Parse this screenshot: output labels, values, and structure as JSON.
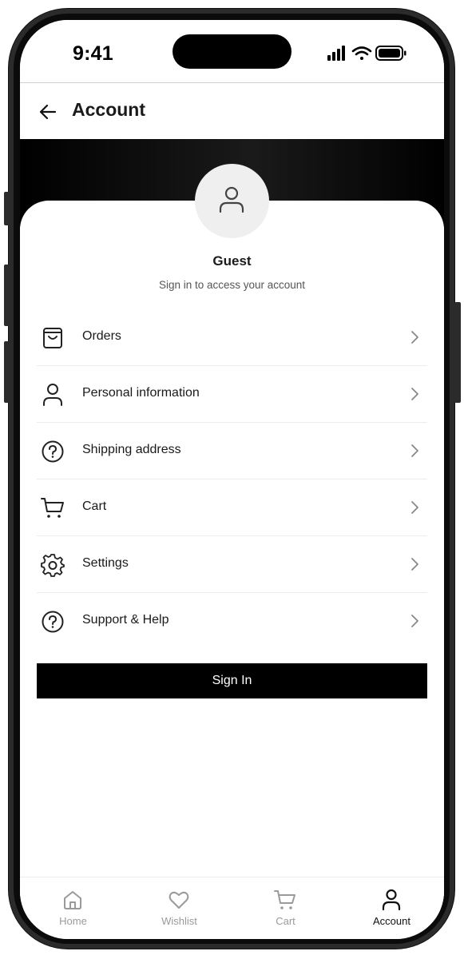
{
  "status_bar": {
    "time": "9:41"
  },
  "header": {
    "title": "Account"
  },
  "profile": {
    "name": "Guest",
    "subtitle": "Sign in to access your account"
  },
  "menu": [
    {
      "label": "Orders",
      "icon": "bag-icon"
    },
    {
      "label": "Personal information",
      "icon": "user-icon"
    },
    {
      "label": "Shipping address",
      "icon": "help-circle-icon"
    },
    {
      "label": "Cart",
      "icon": "cart-icon"
    },
    {
      "label": "Settings",
      "icon": "gear-icon"
    },
    {
      "label": "Support & Help",
      "icon": "help-circle-icon"
    }
  ],
  "signin": {
    "label": "Sign In"
  },
  "bottom_nav": [
    {
      "label": "Home",
      "icon": "home-icon",
      "active": false
    },
    {
      "label": "Wishlist",
      "icon": "heart-icon",
      "active": false
    },
    {
      "label": "Cart",
      "icon": "cart-icon",
      "active": false
    },
    {
      "label": "Account",
      "icon": "user-icon",
      "active": true
    }
  ],
  "colors": {
    "accent": "#000000",
    "inactive": "#9a9a9a",
    "banner": "#000000"
  }
}
